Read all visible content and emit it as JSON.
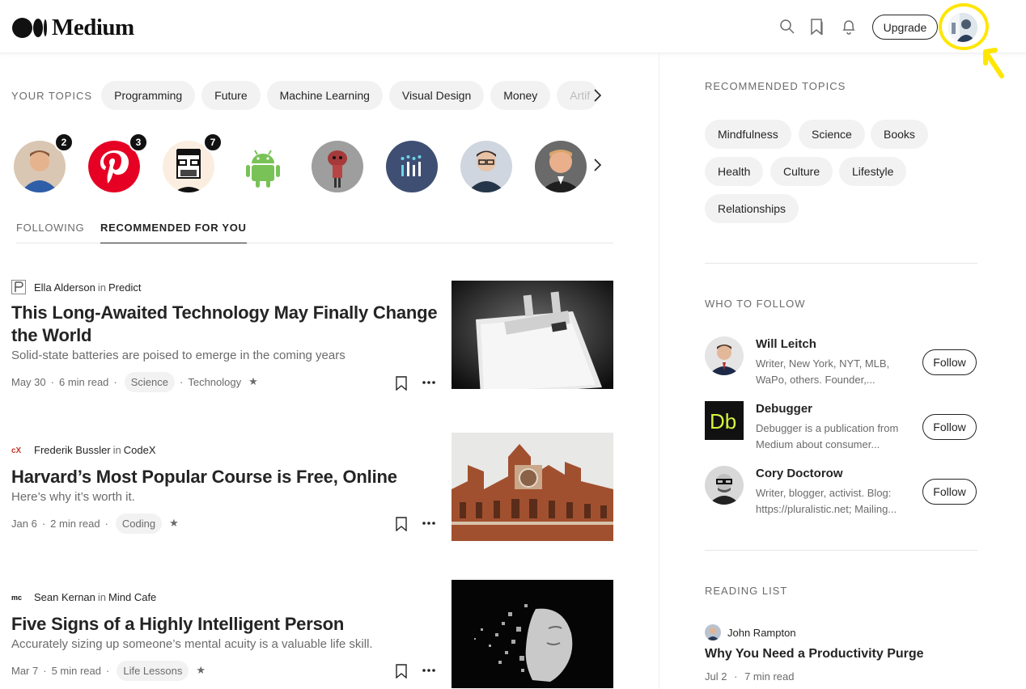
{
  "header": {
    "logo_text": "Medium",
    "upgrade_label": "Upgrade"
  },
  "topics": {
    "label": "YOUR TOPICS",
    "items": [
      "Programming",
      "Future",
      "Machine Learning",
      "Visual Design",
      "Money",
      "Artif"
    ]
  },
  "following_circles": [
    {
      "name": "profile-1",
      "badge": "2"
    },
    {
      "name": "pinterest",
      "badge": "3"
    },
    {
      "name": "profile-3",
      "badge": "7"
    },
    {
      "name": "android",
      "badge": ""
    },
    {
      "name": "profile-5",
      "badge": ""
    },
    {
      "name": "profile-6",
      "badge": ""
    },
    {
      "name": "profile-7",
      "badge": ""
    },
    {
      "name": "profile-8",
      "badge": ""
    }
  ],
  "feed_tabs": {
    "following": "FOLLOWING",
    "recommended": "RECOMMENDED FOR YOU"
  },
  "articles": [
    {
      "author": "Ella Alderson",
      "in_word": "in",
      "publication": "Predict",
      "title": "This Long-Awaited Technology May Finally Change the World",
      "subtitle": "Solid-state batteries are poised to emerge in the coming years",
      "date": "May 30",
      "read_time": "6 min read",
      "tag": "Science",
      "extra": "Technology"
    },
    {
      "author": "Frederik Bussler",
      "in_word": "in",
      "publication": "CodeX",
      "title": "Harvard’s Most Popular Course is Free, Online",
      "subtitle": "Here’s why it’s worth it.",
      "date": "Jan 6",
      "read_time": "2 min read",
      "tag": "Coding",
      "extra": ""
    },
    {
      "author": "Sean Kernan",
      "in_word": "in",
      "publication": "Mind Cafe",
      "title": "Five Signs of a Highly Intelligent Person",
      "subtitle": "Accurately sizing up someone’s mental acuity is a valuable life skill.",
      "date": "Mar 7",
      "read_time": "5 min read",
      "tag": "Life Lessons",
      "extra": ""
    }
  ],
  "recommended_topics": {
    "title": "RECOMMENDED TOPICS",
    "items": [
      "Mindfulness",
      "Science",
      "Books",
      "Health",
      "Culture",
      "Lifestyle",
      "Relationships"
    ]
  },
  "who_to_follow": {
    "title": "WHO TO FOLLOW",
    "follow_label": "Follow",
    "items": [
      {
        "name": "Will Leitch",
        "desc_1": "Writer, New York, NYT, MLB,",
        "desc_2": "WaPo, others. Founder,..."
      },
      {
        "name": "Debugger",
        "desc_1": "Debugger is a publication from",
        "desc_2": "Medium about consumer..."
      },
      {
        "name": "Cory Doctorow",
        "desc_1": "Writer, blogger, activist. Blog:",
        "desc_2": "https://pluralistic.net; Mailing..."
      }
    ]
  },
  "reading_list": {
    "title": "READING LIST",
    "author": "John Rampton",
    "article_title": "Why You Need a Productivity Purge",
    "date": "Jul 2",
    "read_time": "7 min read"
  },
  "icons": {
    "search": "search-icon",
    "bookmarks": "bookmarks-icon",
    "notifications": "bell-icon",
    "chevron": "chevron-right-icon",
    "bookmark": "bookmark-add-icon",
    "more": "more-horizontal-icon"
  },
  "colors": {
    "text": "#242424",
    "muted": "#6b6b6b",
    "pill_bg": "#f2f2f2",
    "highlight": "#ffe600"
  }
}
